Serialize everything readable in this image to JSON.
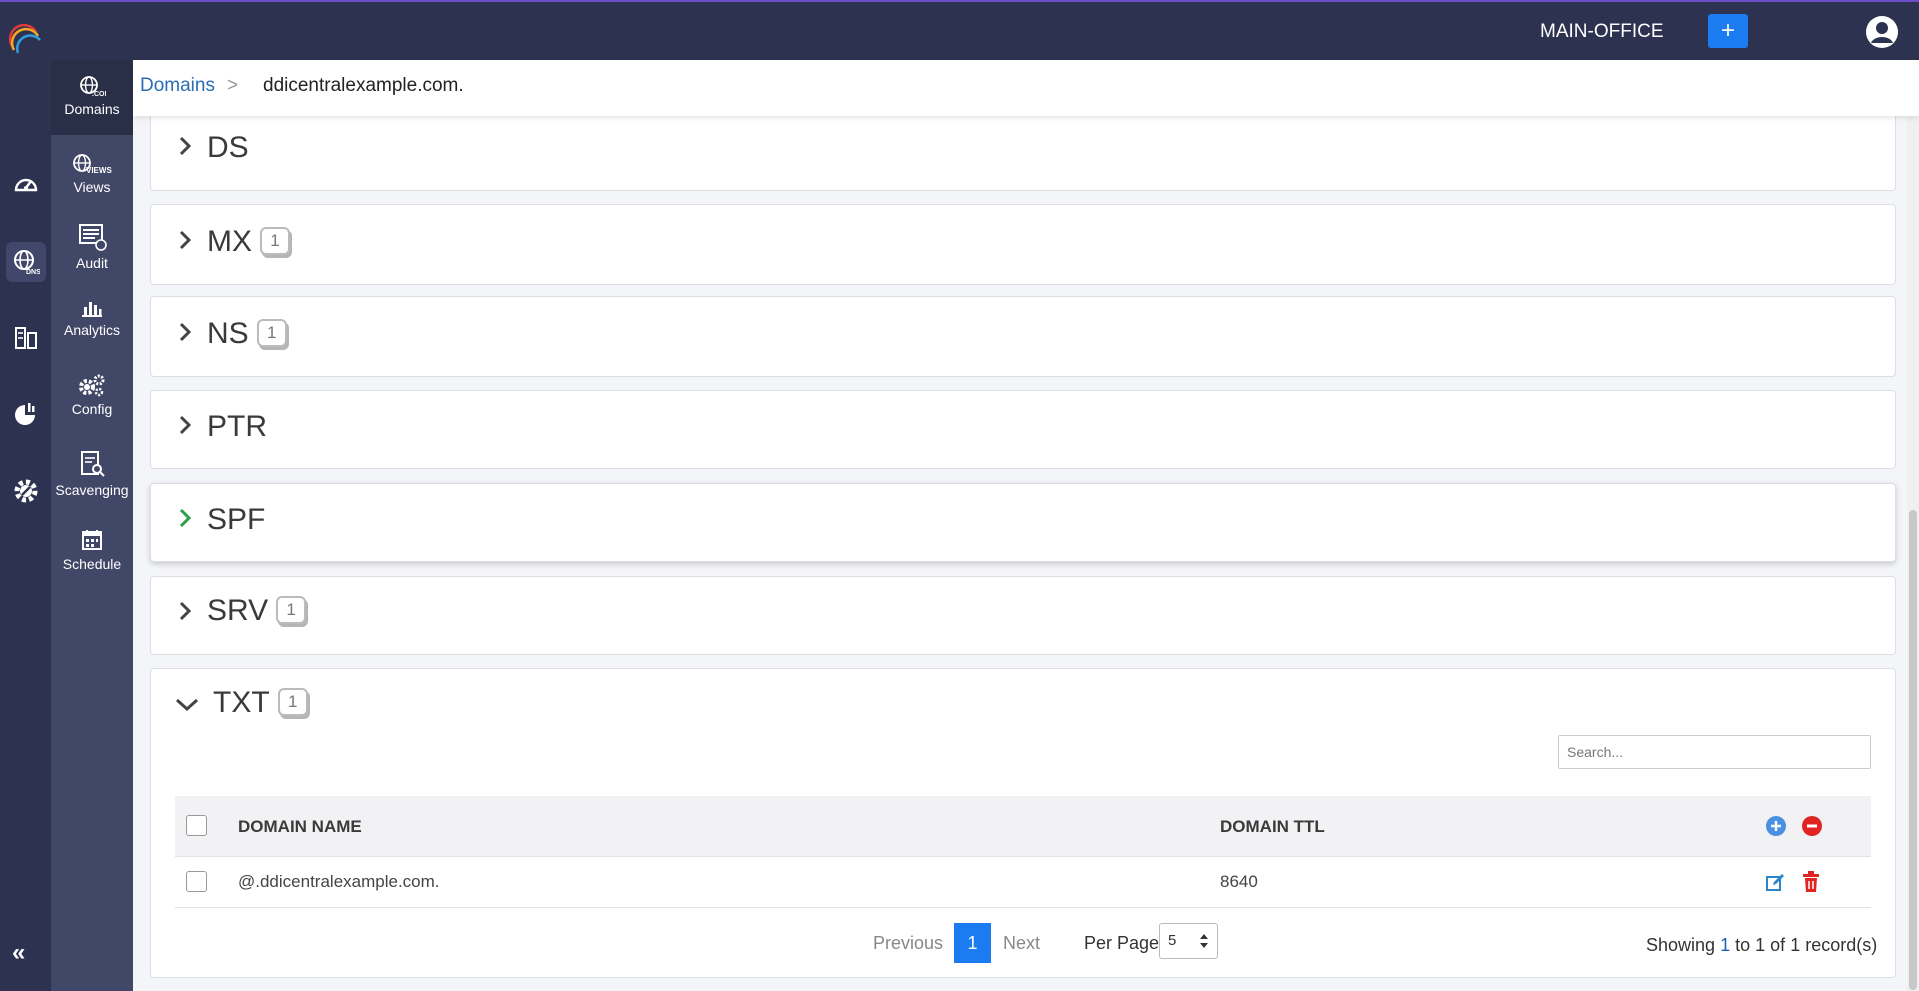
{
  "header": {
    "office": "MAIN-OFFICE",
    "add_label": "+"
  },
  "rail": {
    "items": [
      "dashboard-icon",
      "dns-icon",
      "ipam-icon",
      "reports-icon",
      "settings-icon"
    ],
    "collapse_label": "«"
  },
  "subnav": {
    "items": [
      {
        "label": "Domains",
        "icon": "domains-icon"
      },
      {
        "label": "Views",
        "icon": "views-icon"
      },
      {
        "label": "Audit",
        "icon": "audit-icon"
      },
      {
        "label": "Analytics",
        "icon": "analytics-icon"
      },
      {
        "label": "Config",
        "icon": "config-icon"
      },
      {
        "label": "Scavenging",
        "icon": "scavenging-icon"
      },
      {
        "label": "Schedule",
        "icon": "schedule-icon"
      }
    ]
  },
  "breadcrumb": {
    "root": "Domains",
    "separator": ">",
    "current": "ddicentralexample.com."
  },
  "sections": [
    {
      "title": "DS",
      "count": ""
    },
    {
      "title": "MX",
      "count": "1"
    },
    {
      "title": "NS",
      "count": "1"
    },
    {
      "title": "PTR",
      "count": ""
    },
    {
      "title": "SPF",
      "count": ""
    },
    {
      "title": "SRV",
      "count": "1"
    },
    {
      "title": "TXT",
      "count": "1"
    }
  ],
  "txt_table": {
    "search_placeholder": "Search...",
    "columns": [
      "DOMAIN NAME",
      "DOMAIN TTL"
    ],
    "rows": [
      {
        "domain_name": "@.ddicentralexample.com.",
        "domain_ttl": "8640"
      }
    ]
  },
  "pagination": {
    "previous": "Previous",
    "current_page": "1",
    "next": "Next",
    "per_page_label": "Per Page",
    "per_page_value": "5",
    "showing_prefix": "Showing",
    "from": "1",
    "to_word": "to",
    "to": "1",
    "of_word": "of",
    "total": "1",
    "suffix": "record(s)"
  },
  "colors": {
    "topbar": "#2d3250",
    "subnav": "#414767",
    "accent_blue": "#1a7cf0",
    "spf_chevron": "#2ea043",
    "delete_red": "#e02424"
  }
}
